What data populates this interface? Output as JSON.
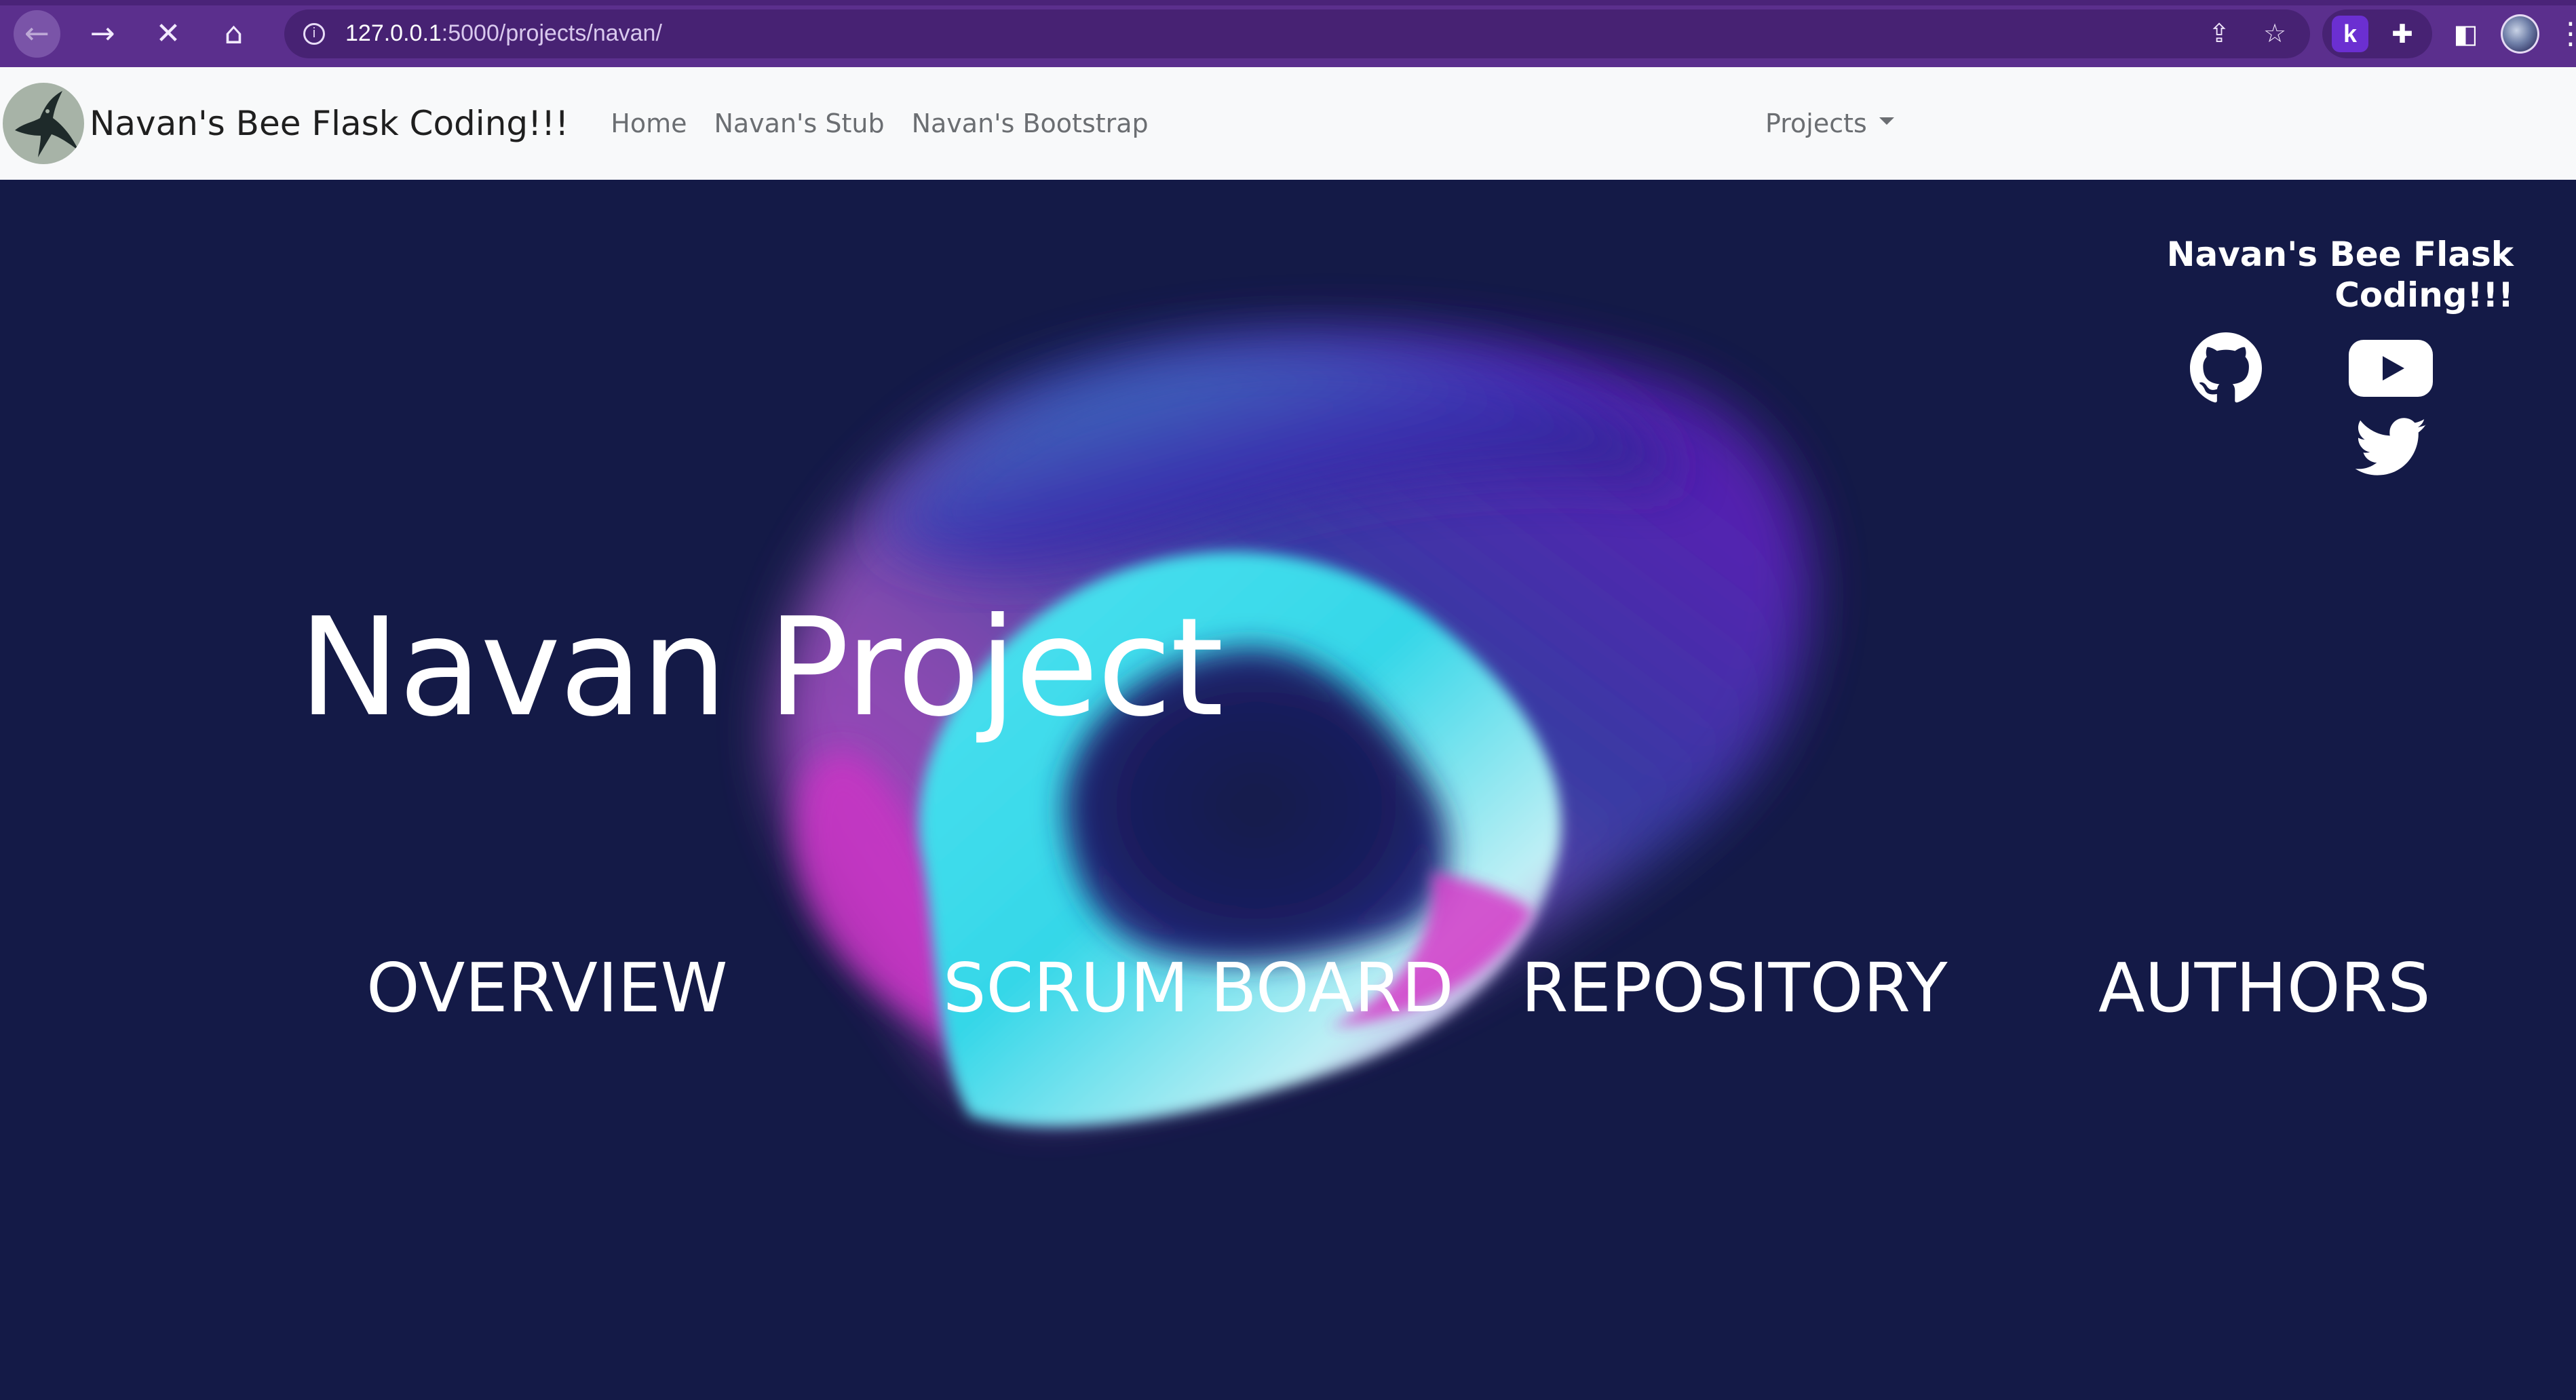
{
  "browser": {
    "back_glyph": "←",
    "forward_glyph": "→",
    "stop_glyph": "✕",
    "home_glyph": "⌂",
    "url_host": "127.0.0.1",
    "url_path": ":5000/projects/navan/",
    "info_glyph": "i",
    "share_glyph": "⇪",
    "star_glyph": "☆",
    "ext_k_label": "k",
    "puzzle_glyph": "✚",
    "sidepanel_glyph": "◧",
    "menu_glyph": "⋮"
  },
  "navbar": {
    "brand": "Navan's Bee Flask Coding!!!",
    "links": [
      "Home",
      "Navan's Stub",
      "Navan's Bootstrap"
    ],
    "dropdown_label": "Projects"
  },
  "hero": {
    "title": "Navan Project",
    "links": [
      "OVERVIEW",
      "SCRUM BOARD",
      "REPOSITORY",
      "AUTHORS"
    ],
    "social_title_line1": "Navan's Bee Flask",
    "social_title_line2": "Coding!!!",
    "social_icons": [
      "github-icon",
      "youtube-icon",
      "twitter-icon"
    ]
  },
  "colors": {
    "browser_frame": "#5b2f8d",
    "navbar_bg": "#f8f9fa",
    "hero_bg": "#141a47",
    "hero_text": "#ffffff"
  }
}
